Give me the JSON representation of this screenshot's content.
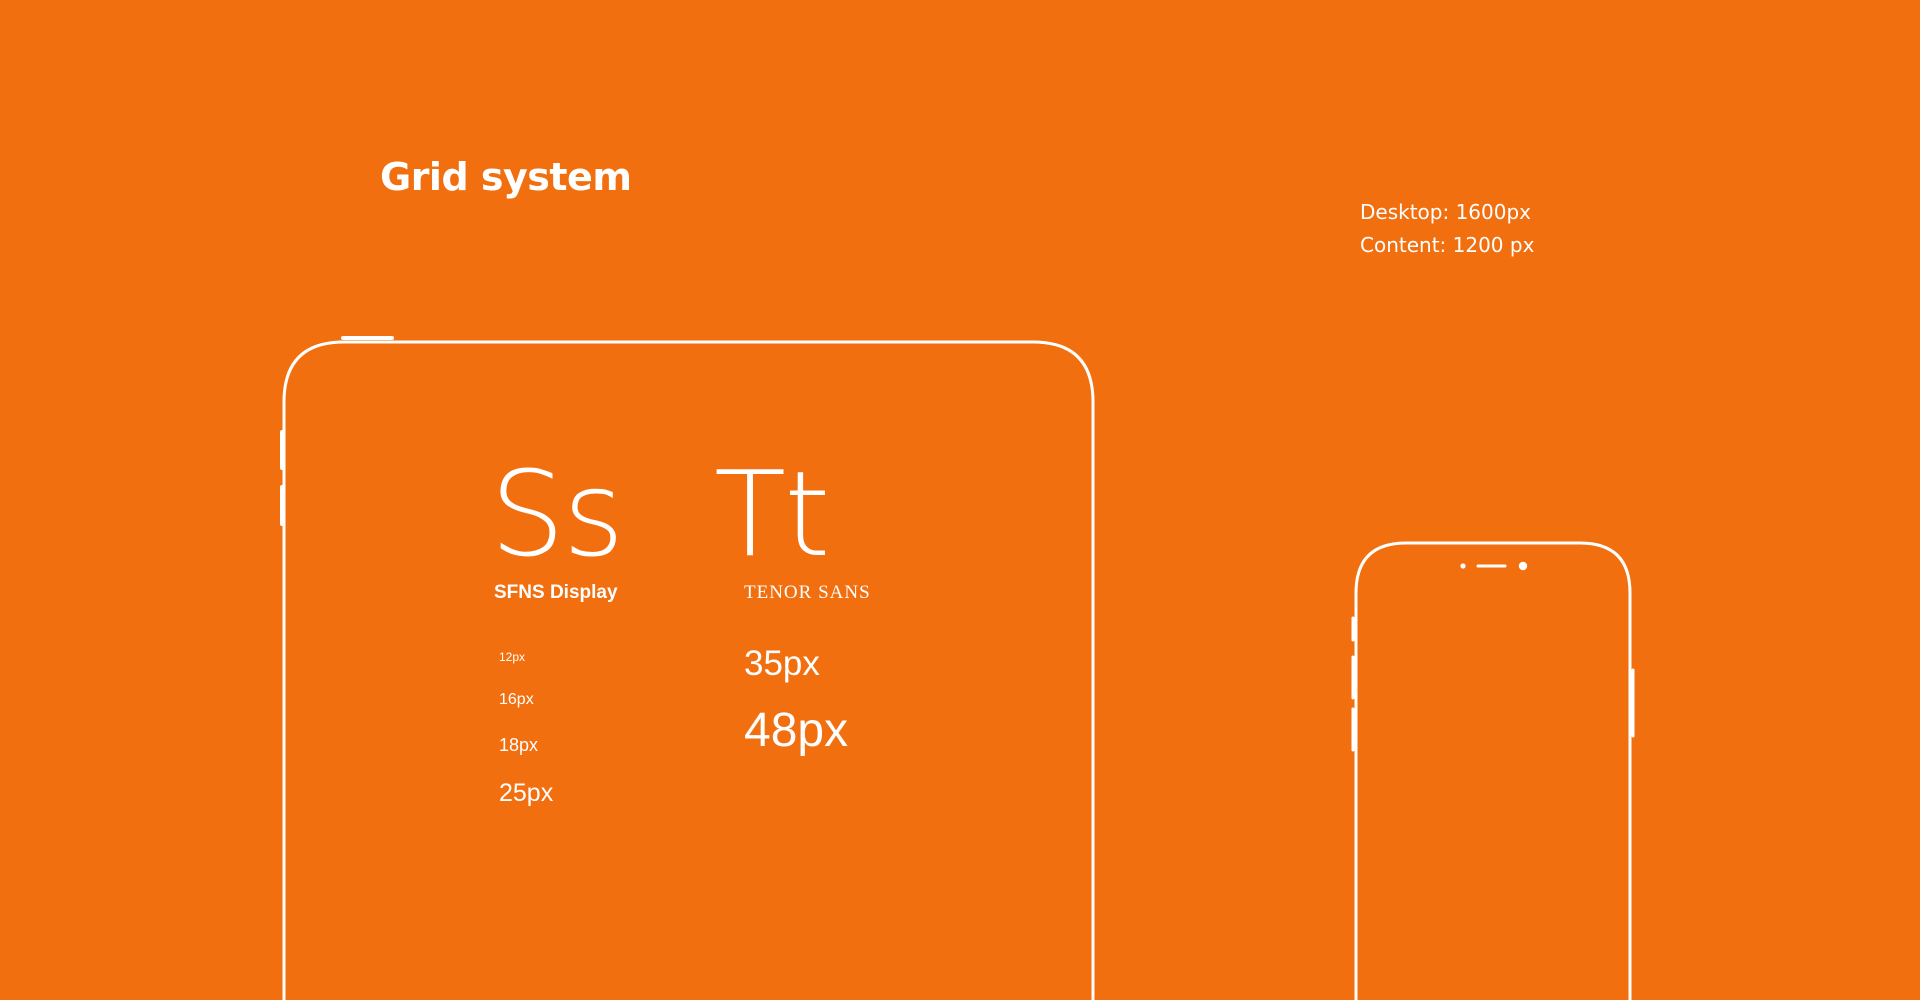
{
  "page": {
    "title": "Grid system",
    "specs": {
      "desktop": "Desktop: 1600px",
      "content": "Content: 1200 px"
    }
  },
  "typography": {
    "primary_font": {
      "glyph": "Ss",
      "name": "SFNS Display",
      "sizes": [
        "12px",
        "16px",
        "18px",
        "25px"
      ]
    },
    "secondary_font": {
      "glyph": "Tt",
      "name": "TENOR SANS",
      "sizes": [
        "35px",
        "48px"
      ]
    }
  },
  "colors": {
    "background": "#f26f0f",
    "foreground": "#ffffff"
  },
  "icons": {
    "tablet": "tablet-outline-icon",
    "phone": "phone-outline-icon"
  }
}
